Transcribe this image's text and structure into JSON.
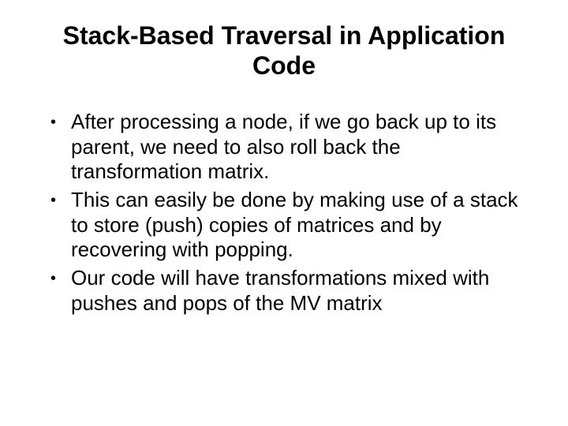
{
  "title": "Stack-Based Traversal in Application Code",
  "bullets": [
    "After processing a node, if we go back up to its parent, we need to also roll back the transformation matrix.",
    "This can easily be done by making use of a stack to store (push) copies of matrices and by recovering with popping.",
    "Our code will have transformations mixed with pushes and pops of the MV matrix"
  ]
}
